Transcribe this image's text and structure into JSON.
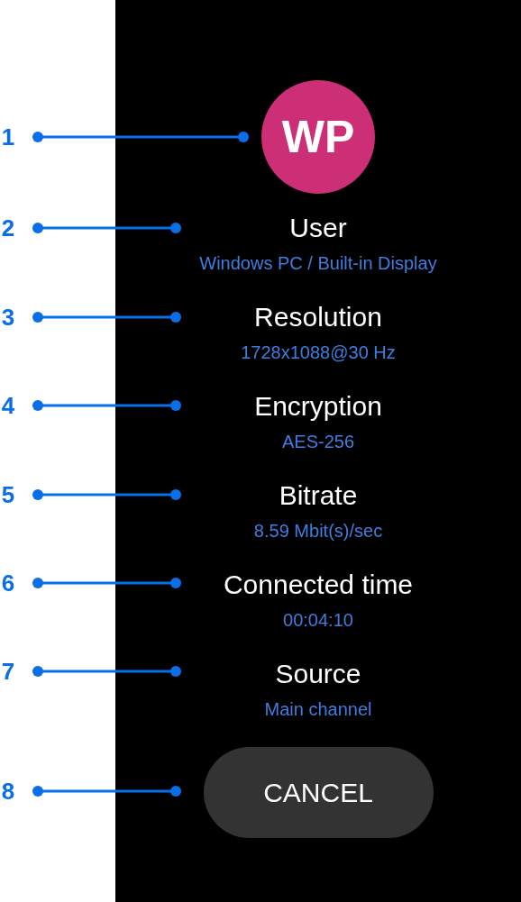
{
  "avatar": {
    "initials": "WP"
  },
  "items": [
    {
      "title": "User",
      "value": "Windows PC / Built-in Display"
    },
    {
      "title": "Resolution",
      "value": "1728x1088@30 Hz"
    },
    {
      "title": "Encryption",
      "value": "AES-256"
    },
    {
      "title": "Bitrate",
      "value": "8.59 Mbit(s)/sec"
    },
    {
      "title": "Connected time",
      "value": "00:04:10"
    },
    {
      "title": "Source",
      "value": "Main channel"
    }
  ],
  "cancel_button": {
    "label": "CANCEL"
  },
  "callouts": [
    "1",
    "2",
    "3",
    "4",
    "5",
    "6",
    "7",
    "8"
  ]
}
